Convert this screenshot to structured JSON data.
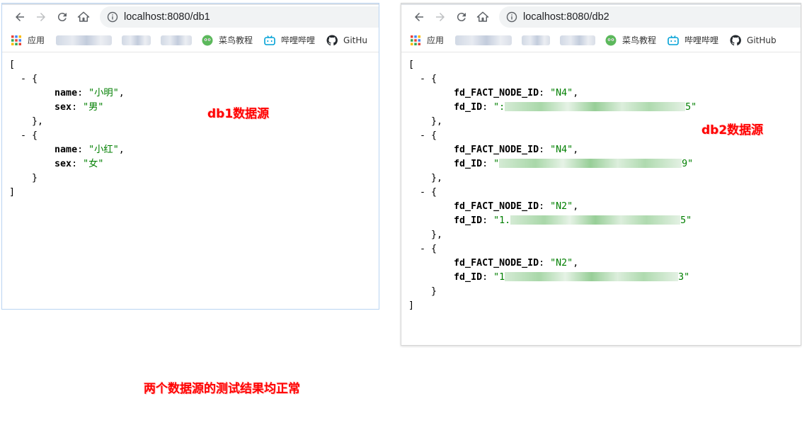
{
  "window1": {
    "url": "localhost:8080/db1",
    "bookmarks": {
      "apps_label": "应用",
      "runoob_label": "菜鸟教程",
      "bilibili_label": "哔哩哔哩",
      "github_label": "GitHu"
    },
    "json_lines": {
      "open_bracket": "[",
      "obj1_open": "  - {",
      "obj1_name_key": "name",
      "obj1_name_val": "\"小明\"",
      "obj1_sex_key": "sex",
      "obj1_sex_val": "\"男\"",
      "obj1_close": "    },",
      "obj2_open": "  - {",
      "obj2_name_key": "name",
      "obj2_name_val": "\"小红\"",
      "obj2_sex_key": "sex",
      "obj2_sex_val": "\"女\"",
      "obj2_close": "    }",
      "close_bracket": "]"
    },
    "annotation": "db1数据源"
  },
  "window2": {
    "url": "localhost:8080/db2",
    "bookmarks": {
      "apps_label": "应用",
      "runoob_label": "菜鸟教程",
      "bilibili_label": "哔哩哔哩",
      "github_label": "GitHub"
    },
    "json_lines": {
      "open_bracket": "[",
      "close_bracket": "]",
      "key_node": "fd_FACT_NODE_ID",
      "key_id": "fd_ID",
      "objects": [
        {
          "node_val": "\"N4\"",
          "id_start": "\":",
          "id_end": "5\""
        },
        {
          "node_val": "\"N4\"",
          "id_start": "\"",
          "id_end": "9\""
        },
        {
          "node_val": "\"N2\"",
          "id_start": "\"1.",
          "id_end": "5\""
        },
        {
          "node_val": "\"N2\"",
          "id_start": "\"1",
          "id_end": "3\""
        }
      ]
    },
    "annotation": "db2数据源"
  },
  "footer_annotation": "两个数据源的测试结果均正常",
  "colors": {
    "annotation": "#ff0000",
    "json_string": "#007f00",
    "omnibox_bg": "#f1f3f4"
  }
}
